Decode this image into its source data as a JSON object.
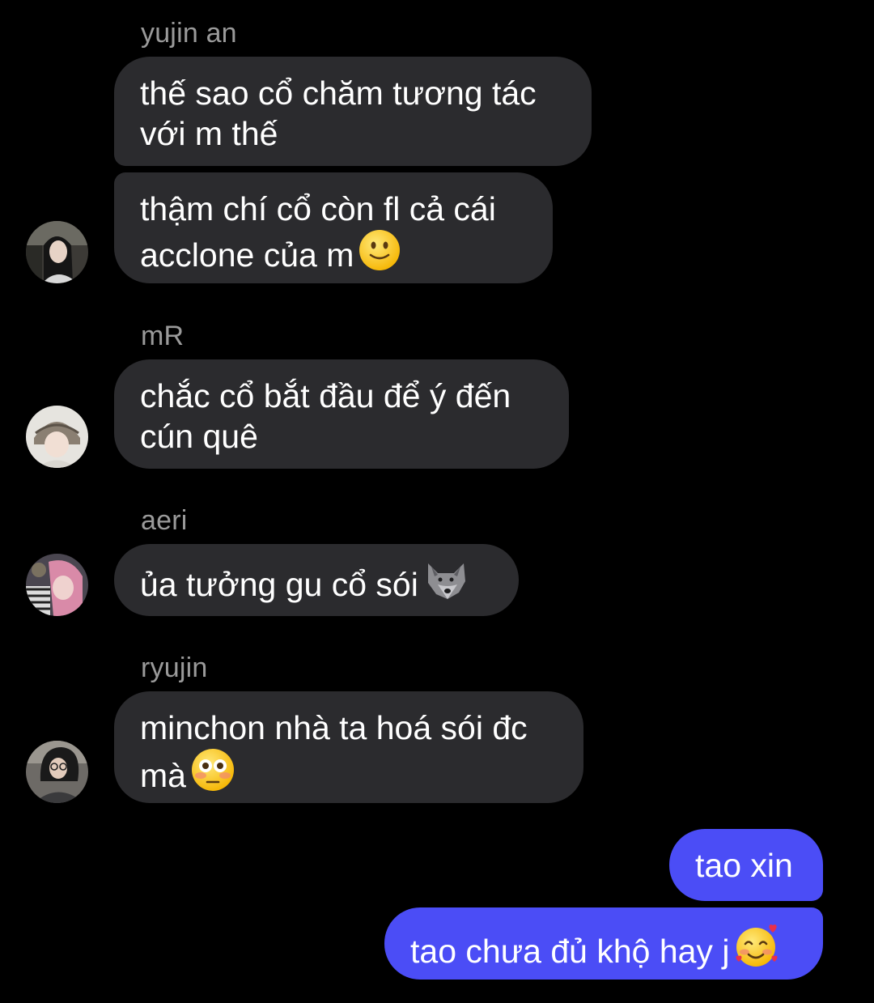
{
  "messages": [
    {
      "sender": "yujin an",
      "lines": [
        "thế sao cổ chăm tương tác",
        "với m thế"
      ]
    },
    {
      "lines": [
        "thậm chí cổ còn fl cả cái",
        "acclone của m"
      ],
      "emoji": "slightly-smiling-face"
    },
    {
      "sender": "mR",
      "lines": [
        "chắc cổ bắt đầu để ý đến",
        "cún quê"
      ]
    },
    {
      "sender": "aeri",
      "lines": [
        "ủa tưởng gu cổ sói"
      ],
      "emoji": "wolf-face"
    },
    {
      "sender": "ryujin",
      "lines": [
        "minchon nhà ta hoá sói đc",
        "mà"
      ],
      "emoji": "flushed-face"
    },
    {
      "outgoing": true,
      "lines": [
        "tao xin"
      ]
    },
    {
      "outgoing": true,
      "lines": [
        "tao chưa đủ khộ hay j"
      ],
      "emoji": "smiling-face-with-hearts"
    }
  ],
  "colors": {
    "background": "#000000",
    "incoming_bubble": "#2b2b2e",
    "outgoing_bubble": "#4b4df6",
    "sender_name": "#9a9a9a"
  }
}
